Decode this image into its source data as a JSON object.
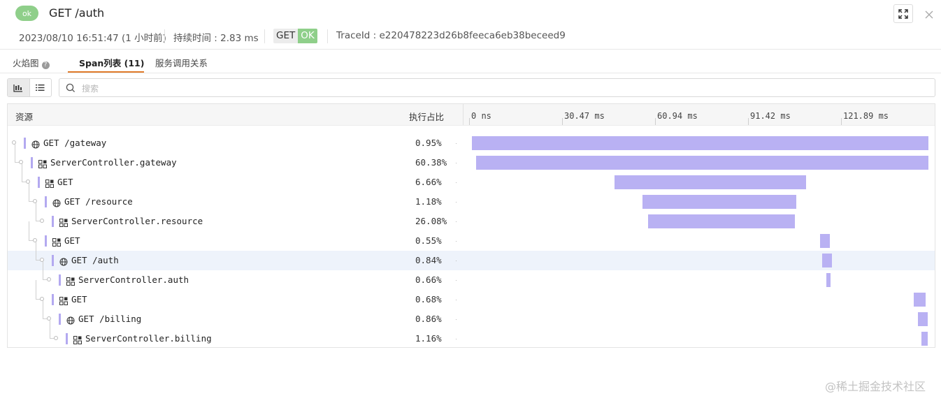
{
  "header": {
    "status_badge": "ok",
    "title": "GET /auth",
    "timestamp": "2023/08/10 16:51:47 (1 小时前)",
    "duration": "持续时间 : 2.83 ms",
    "method": "GET",
    "status": "OK",
    "trace_id": "TraceId : e220478223d26b8feeca6eb38beceed9"
  },
  "tabs": [
    {
      "label": "火焰图"
    },
    {
      "label": "Span列表 (11)"
    },
    {
      "label": "服务调用关系"
    }
  ],
  "search": {
    "placeholder": "搜索",
    "value": ""
  },
  "table": {
    "col_resource": "资源",
    "col_percent": "执行占比",
    "ticks": [
      "0 ns",
      "30.47 ms",
      "60.94 ms",
      "91.42 ms",
      "121.89 ms"
    ]
  },
  "spans": [
    {
      "name": "GET /gateway",
      "percent": "0.95%",
      "depth": 0,
      "icon": "globe-icon",
      "start": 0.0,
      "end": 1.0
    },
    {
      "name": "ServerController.gateway",
      "percent": "60.38%",
      "depth": 1,
      "icon": "component-icon",
      "start": 0.009,
      "end": 1.0
    },
    {
      "name": "GET",
      "percent": "6.66%",
      "depth": 2,
      "icon": "component-icon",
      "start": 0.312,
      "end": 0.732
    },
    {
      "name": "GET /resource",
      "percent": "1.18%",
      "depth": 3,
      "icon": "globe-icon",
      "start": 0.373,
      "end": 0.71
    },
    {
      "name": "ServerController.resource",
      "percent": "26.08%",
      "depth": 4,
      "icon": "component-icon",
      "start": 0.386,
      "end": 0.707
    },
    {
      "name": "GET",
      "percent": "0.55%",
      "depth": 3,
      "icon": "component-icon",
      "start": 0.762,
      "end": 0.784
    },
    {
      "name": "GET /auth",
      "percent": "0.84%",
      "depth": 4,
      "icon": "globe-icon",
      "start": 0.767,
      "end": 0.788,
      "selected": true
    },
    {
      "name": "ServerController.auth",
      "percent": "0.66%",
      "depth": 5,
      "icon": "component-icon",
      "start": 0.777,
      "end": 0.785
    },
    {
      "name": "GET",
      "percent": "0.68%",
      "depth": 4,
      "icon": "component-icon",
      "start": 0.968,
      "end": 0.994
    },
    {
      "name": "GET /billing",
      "percent": "0.86%",
      "depth": 5,
      "icon": "globe-icon",
      "start": 0.977,
      "end": 0.998
    },
    {
      "name": "ServerController.billing",
      "percent": "1.16%",
      "depth": 6,
      "icon": "component-icon",
      "start": 0.984,
      "end": 0.998
    }
  ],
  "watermark": "@稀土掘金技术社区",
  "colors": {
    "ok": "#8fcf8a",
    "span_bar": "#b9b1f3",
    "active_tab": "#e07b2b"
  }
}
